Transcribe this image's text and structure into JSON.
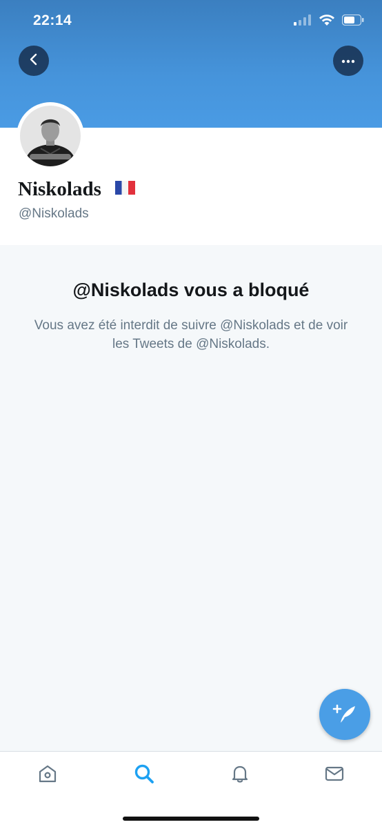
{
  "status_bar": {
    "time": "22:14"
  },
  "header": {
    "back_icon": "chevron-left-icon",
    "more_icon": "ellipsis-icon",
    "banner_color": "#4694db"
  },
  "profile": {
    "display_name": "Niskolads",
    "flag": "🇫🇷",
    "handle": "@Niskolads"
  },
  "blocked": {
    "title": "@Niskolads vous a bloqué",
    "description": "Vous avez été interdit de suivre @Niskolads et de voir les Tweets de @Niskolads."
  },
  "fab": {
    "icon": "compose-tweet-icon",
    "color": "#4a9ee6"
  },
  "tab_bar": {
    "tabs": [
      {
        "icon": "home-icon",
        "active": false
      },
      {
        "icon": "search-icon",
        "active": true
      },
      {
        "icon": "bell-icon",
        "active": false
      },
      {
        "icon": "mail-icon",
        "active": false
      }
    ],
    "active_color": "#1da1f2",
    "inactive_color": "#657786"
  }
}
